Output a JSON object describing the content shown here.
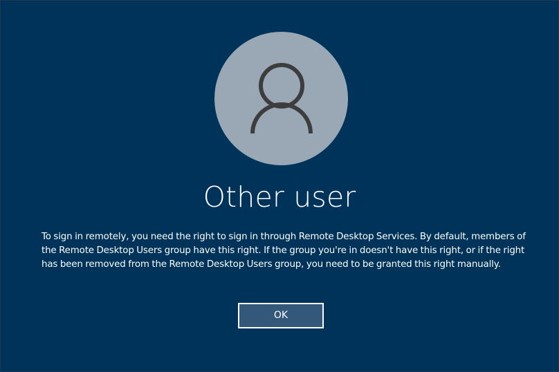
{
  "login": {
    "avatar_icon": "user-silhouette-icon",
    "username": "Other user",
    "message": "To sign in remotely, you need the right to sign in through Remote Desktop Services. By default, members of the Remote Desktop Users group have this right. If the group you're in doesn't have this right, or if the right has been removed from the Remote Desktop Users group, you need to be granted this right manually.",
    "ok_label": "OK"
  },
  "colors": {
    "background": "#003359",
    "avatar_circle": "#9aa8b6",
    "avatar_glyph": "#3d3d3d",
    "button_fill": "#33587a",
    "button_border": "#ffffff",
    "text": "#ffffff"
  }
}
